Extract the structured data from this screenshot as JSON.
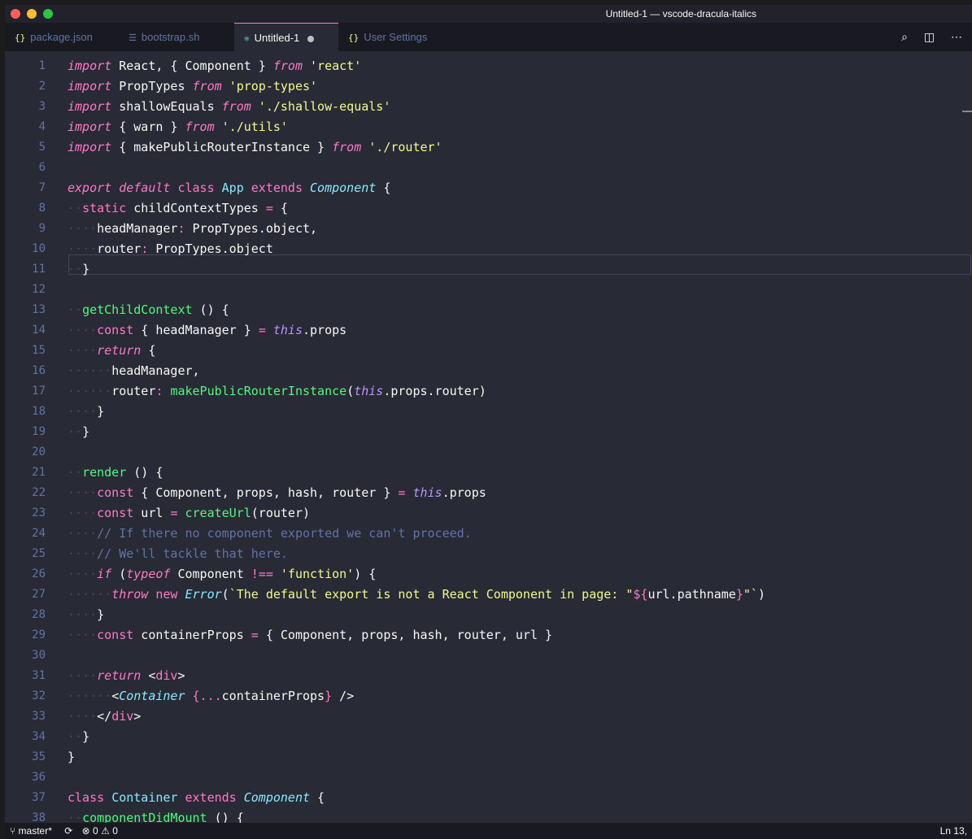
{
  "window": {
    "title": "Untitled-1 — vscode-dracula-italics"
  },
  "tabs": [
    {
      "icon": "{}",
      "label": "package.json"
    },
    {
      "icon": "☰",
      "label": "bootstrap.sh"
    },
    {
      "icon": "⚛",
      "label": "Untitled-1"
    },
    {
      "icon": "{}",
      "label": "User Settings"
    }
  ],
  "lines": [
    "1",
    "2",
    "3",
    "4",
    "5",
    "6",
    "7",
    "8",
    "9",
    "10",
    "11",
    "12",
    "13",
    "14",
    "15",
    "16",
    "17",
    "18",
    "19",
    "20",
    "21",
    "22",
    "23",
    "24",
    "25",
    "26",
    "27",
    "28",
    "29",
    "30",
    "31",
    "32",
    "33",
    "34",
    "35",
    "36",
    "37",
    "38"
  ],
  "status": {
    "branch": "master*",
    "errors": "0",
    "warnings": "0",
    "position": "Ln 13,"
  },
  "icons": {
    "tab_actions": [
      "search-icon",
      "split-editor-icon",
      "more-icon"
    ],
    "branch_icon": "git-branch-icon",
    "sync_icon": "sync-icon"
  }
}
